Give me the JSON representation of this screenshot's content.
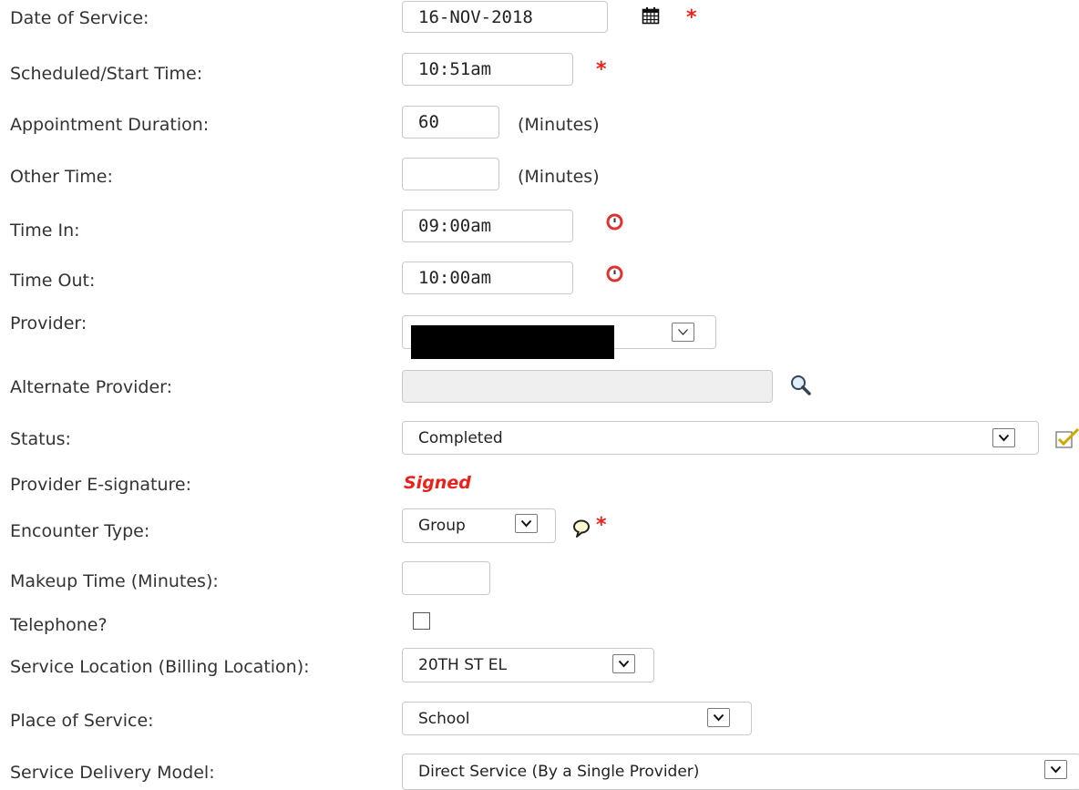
{
  "form": {
    "date_of_service": {
      "label": "Date of Service:",
      "value": "16-NOV-2018",
      "required": "*"
    },
    "start_time": {
      "label": "Scheduled/Start Time:",
      "value": "10:51am",
      "required": "*"
    },
    "duration": {
      "label": "Appointment Duration:",
      "value": "60",
      "unit": "(Minutes)"
    },
    "other_time": {
      "label": "Other Time:",
      "value": "",
      "unit": "(Minutes)"
    },
    "time_in": {
      "label": "Time In:",
      "value": "09:00am"
    },
    "time_out": {
      "label": "Time Out:",
      "value": "10:00am"
    },
    "provider": {
      "label": "Provider:"
    },
    "alternate_provider": {
      "label": "Alternate Provider:",
      "value": ""
    },
    "status": {
      "label": "Status:",
      "value": "Completed"
    },
    "e_signature": {
      "label": "Provider E-signature:",
      "value": "Signed"
    },
    "encounter_type": {
      "label": "Encounter Type:",
      "value": "Group",
      "required": "*"
    },
    "makeup_time": {
      "label": "Makeup Time (Minutes):",
      "value": ""
    },
    "telephone": {
      "label": "Telephone?",
      "checked": false
    },
    "service_location": {
      "label": "Service Location (Billing Location):",
      "value": "20TH ST EL"
    },
    "place_of_service": {
      "label": "Place of Service:",
      "value": "School"
    },
    "service_delivery_model": {
      "label": "Service Delivery Model:",
      "value": "Direct Service (By a Single Provider)"
    }
  },
  "colors": {
    "required": "#e8231c",
    "signed": "#e8231c",
    "field_border": "#c9c9c9",
    "disabled_bg": "#efefef"
  },
  "icons": [
    "calendar-icon",
    "clock-warning-icon",
    "search-icon",
    "checkmark-icon",
    "speech-bubble-icon",
    "chevron-down-icon"
  ]
}
